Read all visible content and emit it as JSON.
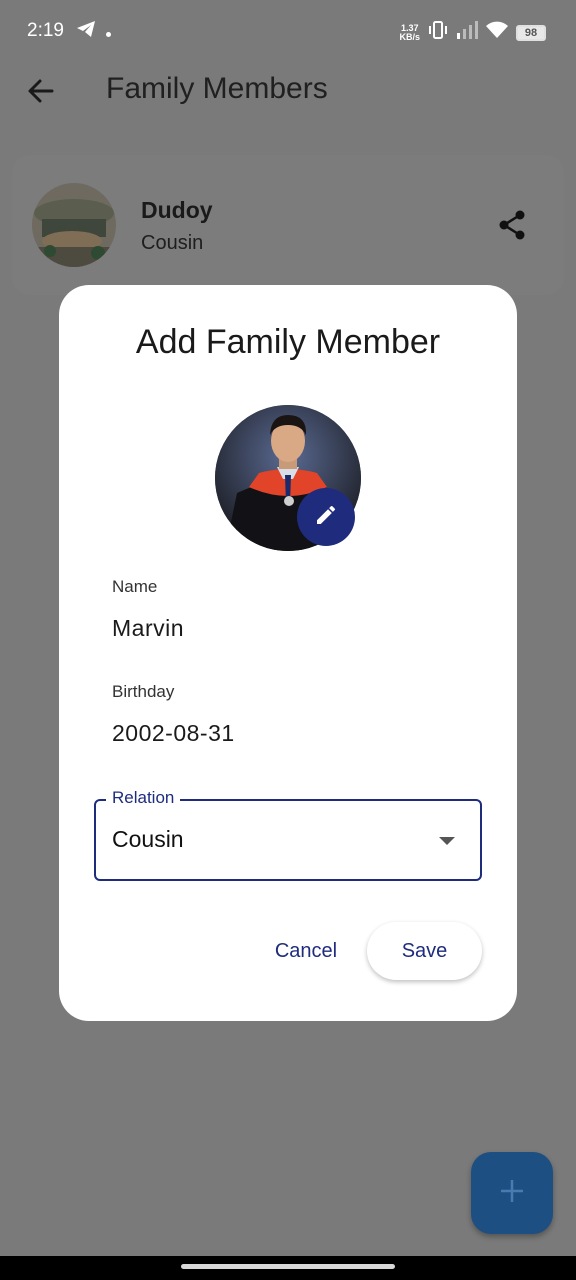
{
  "status_bar": {
    "time": "2:19",
    "net_speed_value": "1.37",
    "net_speed_unit": "KB/s",
    "battery": "98"
  },
  "app_bar": {
    "title": "Family Members"
  },
  "member": {
    "name": "Dudoy",
    "relation": "Cousin"
  },
  "dialog": {
    "title": "Add Family Member",
    "name_label": "Name",
    "name_value": "Marvin",
    "birthday_label": "Birthday",
    "birthday_value": "2002-08-31",
    "relation_label": "Relation",
    "relation_value": "Cousin",
    "cancel_label": "Cancel",
    "save_label": "Save"
  },
  "colors": {
    "accent": "#1f2c7e",
    "fab": "#1e4f82",
    "scrim": "#7a7a7a"
  }
}
